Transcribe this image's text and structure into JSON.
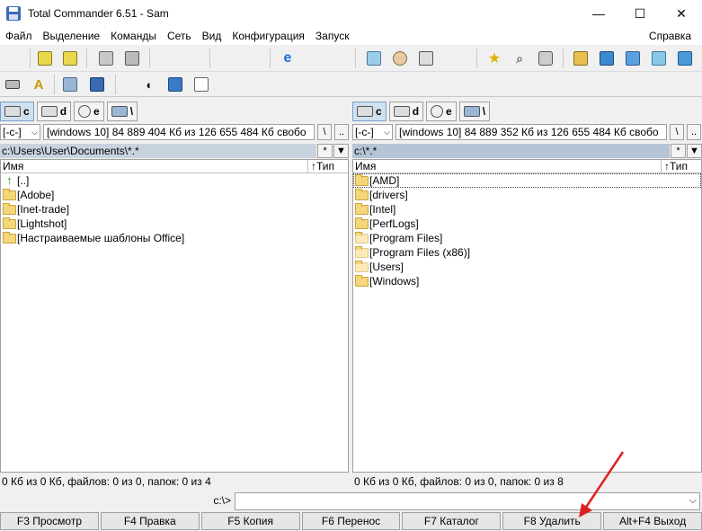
{
  "window": {
    "title": "Total Commander 6.51 - Sam",
    "minimize_icon": "—",
    "maximize_icon": "☐",
    "close_icon": "✕"
  },
  "menu": {
    "items": [
      "Файл",
      "Выделение",
      "Команды",
      "Сеть",
      "Вид",
      "Конфигурация",
      "Запуск"
    ],
    "help": "Справка"
  },
  "left": {
    "drives": [
      "c",
      "d",
      "e",
      "\\"
    ],
    "drive_combo": "[-c-]",
    "volume_info": "[windows 10]  84 889 404 Кб из 126 655 484 Кб свобо",
    "root_btn": "\\",
    "parent_btn": "..",
    "path": "c:\\Users\\User\\Documents\\*.*",
    "star_btn": "*",
    "hist_btn": "▼",
    "col_name": "Имя",
    "col_type": "↑Тип",
    "rows": [
      "[..]",
      "[Adobe]",
      "[Inet-trade]",
      "[Lightshot]",
      "[Настраиваемые шаблоны Office]"
    ],
    "status": "0 Кб из 0 Кб, файлов: 0 из 0, папок: 0 из 4"
  },
  "right": {
    "drives": [
      "c",
      "d",
      "e",
      "\\"
    ],
    "drive_combo": "[-c-]",
    "volume_info": "[windows 10]  84 889 352 Кб из 126 655 484 Кб свобо",
    "root_btn": "\\",
    "parent_btn": "..",
    "path": "c:\\*.*",
    "star_btn": "*",
    "hist_btn": "▼",
    "col_name": "Имя",
    "col_type": "↑Тип",
    "rows": [
      "[AMD]",
      "[drivers]",
      "[Intel]",
      "[PerfLogs]",
      "[Program Files]",
      "[Program Files (x86)]",
      "[Users]",
      "[Windows]"
    ],
    "status": "0 Кб из 0 Кб, файлов: 0 из 0, папок: 0 из 8"
  },
  "command": {
    "label": "c:\\>",
    "value": "",
    "dropdown_icon": "chevron-down-icon"
  },
  "fkeys": [
    "F3 Просмотр",
    "F4 Правка",
    "F5 Копия",
    "F6 Перенос",
    "F7 Каталог",
    "F8 Удалить",
    "Alt+F4 Выход"
  ],
  "colors": {
    "accent_arrow": "#e02020",
    "path_active": "#b6c5d6",
    "folder": "#f5d67a"
  }
}
